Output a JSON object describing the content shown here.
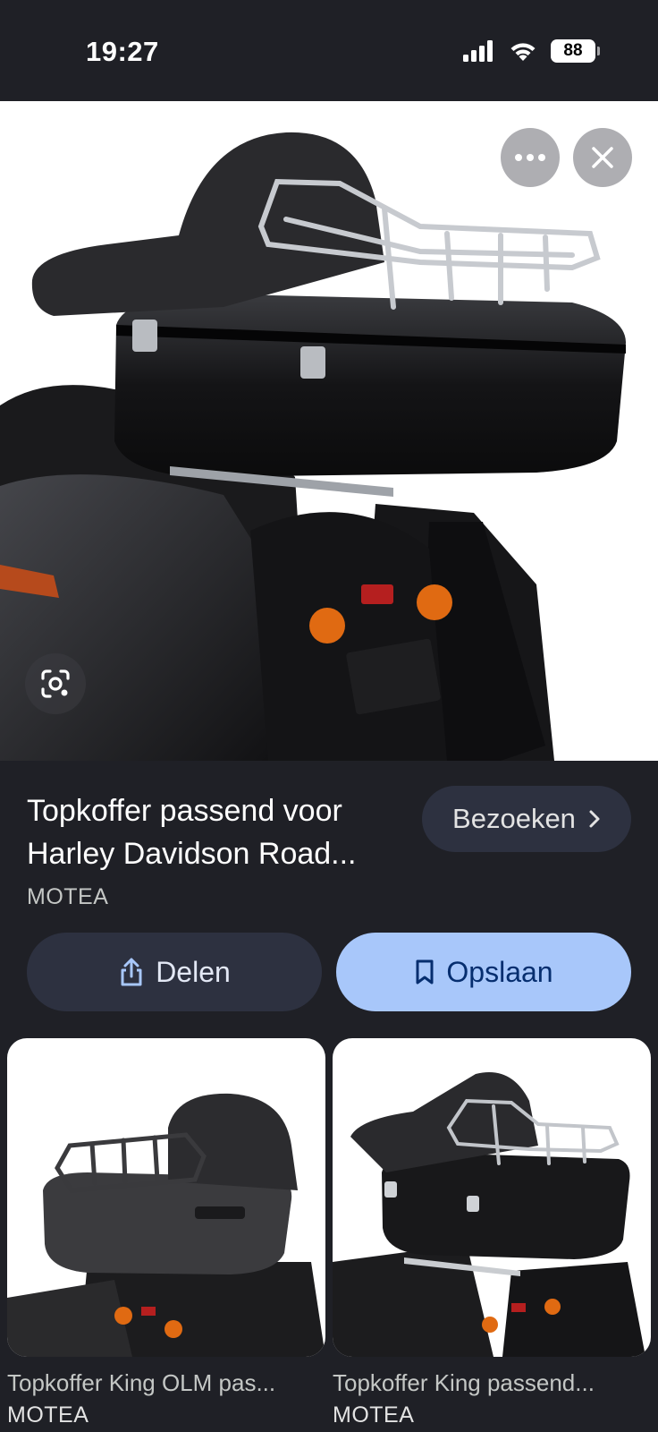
{
  "status_bar": {
    "time": "19:27",
    "battery": "88",
    "icons": [
      "signal-icon",
      "wifi-icon",
      "battery-icon"
    ]
  },
  "viewer": {
    "icons": [
      "more-icon",
      "close-icon",
      "google-lens-icon"
    ]
  },
  "result": {
    "title": "Topkoffer passend voor Harley Davidson Road...",
    "source": "MOTEA",
    "visit_label": "Bezoeken",
    "share_label": "Delen",
    "save_label": "Opslaan"
  },
  "related": [
    {
      "title": "Topkoffer King OLM pas...",
      "source": "MOTEA"
    },
    {
      "title": "Topkoffer King passend...",
      "source": "MOTEA"
    }
  ],
  "colors": {
    "background": "#1f2026",
    "button_dark": "#2d3140",
    "button_primary": "#a8c7fa",
    "primary_text": "#062e6f"
  }
}
